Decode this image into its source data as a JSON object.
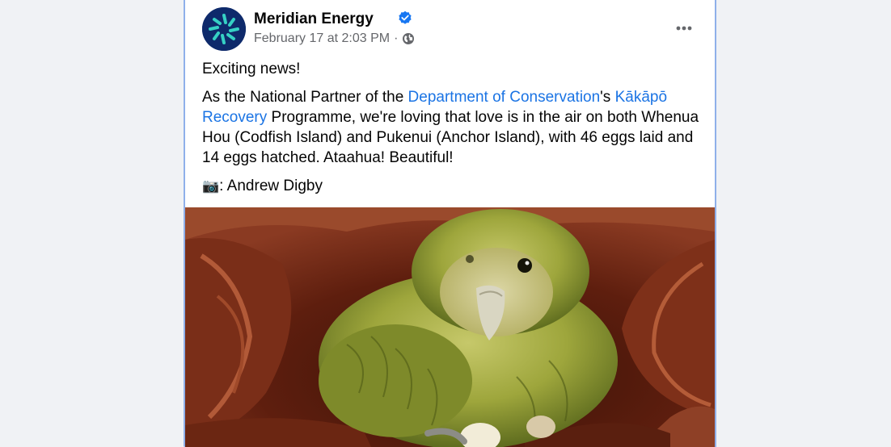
{
  "post": {
    "page_name": "Meridian Energy",
    "timestamp": "February 17 at 2:03 PM",
    "separator": "·",
    "audience_icon": "globe-icon",
    "more_icon": "more-horizontal-icon",
    "verified_icon": "verified-badge-icon",
    "text": {
      "line1": "Exciting news!",
      "p2_before": "As the National Partner of the ",
      "p2_link1": "Department of Conservation",
      "p2_mid": "'s ",
      "p2_link2": "Kākāpō Recovery",
      "p2_after": " Programme, we're loving that love is in the air on both Whenua Hou (Codfish Island) and Pukenui (Anchor Island), with 46 eggs laid and 14 eggs hatched.  Ataahua! Beautiful!",
      "credit_icon": "📷",
      "credit": ": Andrew Digby"
    },
    "photo_subject": "kakapo parrot on nest with egg"
  },
  "colors": {
    "link": "#1b74e4",
    "meta": "#65676b",
    "verified": "#1877f2",
    "avatar_bg": "#0e2a6b",
    "avatar_accent": "#36d1c4"
  }
}
